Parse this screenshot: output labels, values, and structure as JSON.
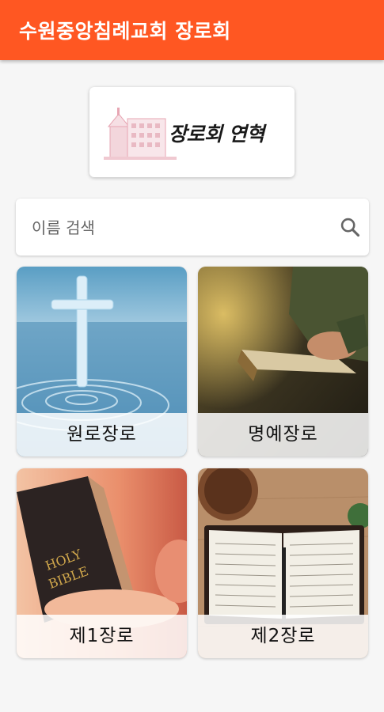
{
  "appbar": {
    "title": "수원중앙침례교회 장로회",
    "color": "#ff5722"
  },
  "history": {
    "label": "장로회 연혁"
  },
  "search": {
    "placeholder": "이름 검색",
    "icon": "search-icon"
  },
  "tiles": [
    {
      "label": "원로장로",
      "image": "cross-water"
    },
    {
      "label": "명예장로",
      "image": "reading-bible"
    },
    {
      "label": "제1장로",
      "image": "holy-bible"
    },
    {
      "label": "제2장로",
      "image": "open-bible-coffee"
    }
  ]
}
